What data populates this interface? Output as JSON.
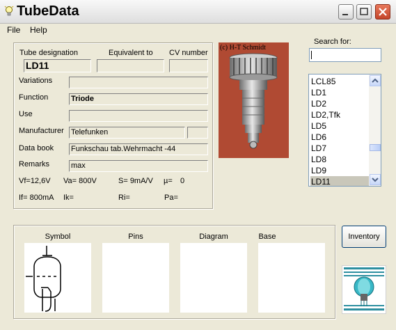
{
  "window": {
    "title": "TubeData"
  },
  "menu": {
    "file": "File",
    "help": "Help"
  },
  "headers": {
    "designation": "Tube designation",
    "equivalent": "Equivalent to",
    "cv": "CV number"
  },
  "tube": {
    "designation": "LD11",
    "equivalent": "",
    "cv": "",
    "variations": "",
    "function": "Triode",
    "use": "",
    "manufacturer": "Telefunken",
    "manufacturer_extra": "",
    "databook": "Funkschau tab.Wehrmacht -44",
    "remarks": "max"
  },
  "labels": {
    "variations": "Variations",
    "function": "Function",
    "use": "Use",
    "manufacturer": "Manufacturer",
    "databook": "Data book",
    "remarks": "Remarks"
  },
  "params": {
    "vf": "Vf=12,6V",
    "va": "Va= 800V",
    "s": "S= 9mA/V",
    "mu": "µ=",
    "mu_val": "0",
    "if": "If= 800mA",
    "ik": "Ik=",
    "ri": "Ri=",
    "pa": "Pa="
  },
  "photo": {
    "caption": "(c) H-T Schmidt"
  },
  "search": {
    "label": "Search for:",
    "value": ""
  },
  "list": {
    "items": [
      "LCL85",
      "LD1",
      "LD2",
      "LD2,Tfk",
      "LD5",
      "LD6",
      "LD7",
      "LD8",
      "LD9",
      "LD11"
    ],
    "selected": "LD11"
  },
  "sections": {
    "symbol": "Symbol",
    "pins": "Pins",
    "diagram": "Diagram",
    "base": "Base"
  },
  "buttons": {
    "inventory": "Inventory"
  },
  "icons": {
    "app": "lightbulb-icon",
    "minimize": "minimize-icon",
    "maximize": "maximize-icon",
    "close": "close-icon"
  },
  "colors": {
    "photo_bg": "#b04a33",
    "selection": "#c9c7ba",
    "window_bg": "#ece9d8"
  }
}
